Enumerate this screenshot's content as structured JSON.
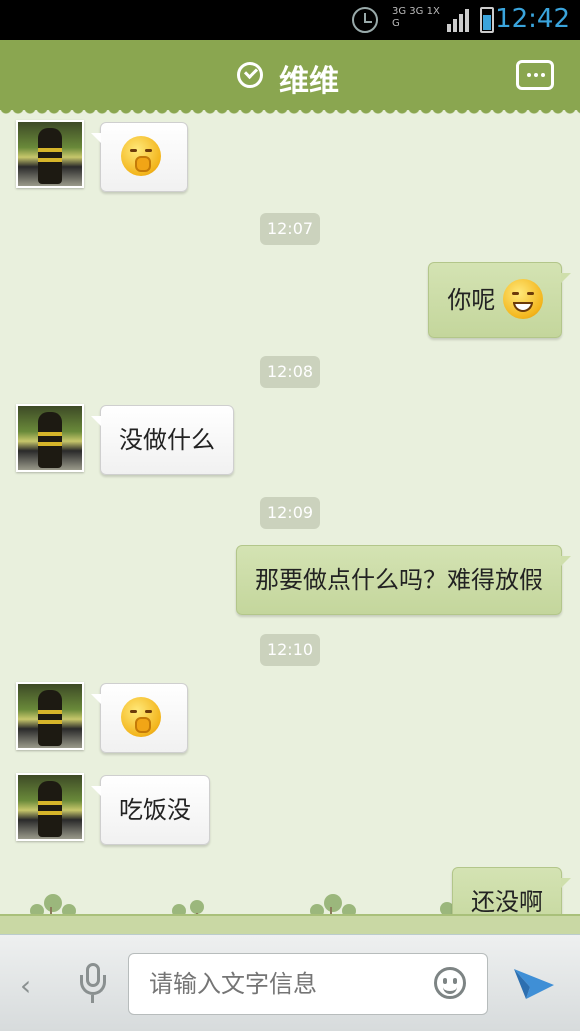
{
  "status_bar": {
    "time": "12:42",
    "network": "3G 3G 1X G"
  },
  "header": {
    "title": "维维"
  },
  "messages": [
    {
      "side": "left",
      "emoji": "crying-emoji"
    },
    {
      "side": "time",
      "text": "12:07"
    },
    {
      "side": "right",
      "text": "你呢",
      "emoji": "grinning-emoji"
    },
    {
      "side": "time",
      "text": "12:08"
    },
    {
      "side": "left",
      "text": "没做什么"
    },
    {
      "side": "time",
      "text": "12:09"
    },
    {
      "side": "right",
      "text": "那要做点什么吗？难得放假"
    },
    {
      "side": "time",
      "text": "12:10"
    },
    {
      "side": "left",
      "emoji": "yawning-emoji"
    },
    {
      "side": "left",
      "text": "吃饭没"
    },
    {
      "side": "right",
      "text": "还没啊"
    }
  ],
  "input": {
    "placeholder": "请输入文字信息"
  },
  "colors": {
    "header": "#8aa650",
    "background": "#e9f0dd",
    "accent": "#3aa4dc"
  }
}
